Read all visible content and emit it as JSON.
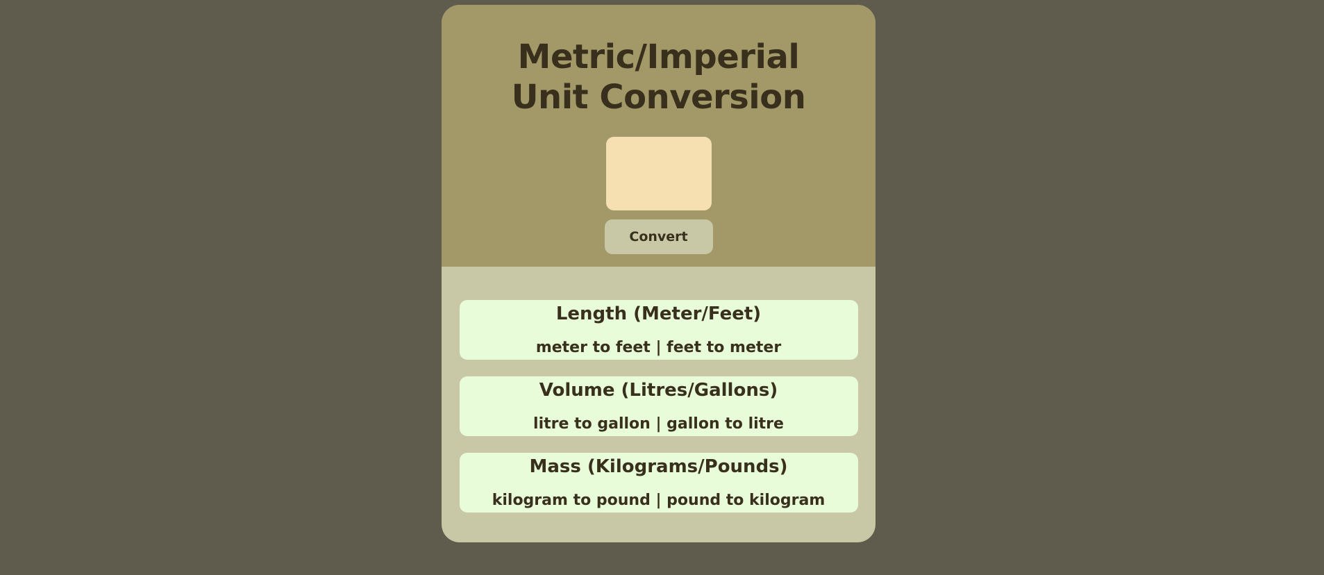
{
  "header": {
    "title": "Metric/Imperial Unit Conversion",
    "input_value": "",
    "convert_label": "Convert"
  },
  "results": [
    {
      "title": "Length (Meter/Feet)",
      "text": "meter to feet | feet to meter"
    },
    {
      "title": "Volume (Litres/Gallons)",
      "text": "litre to gallon | gallon to litre"
    },
    {
      "title": "Mass (Kilograms/Pounds)",
      "text": "kilogram to pound | pound to kilogram"
    }
  ],
  "colors": {
    "page_background": "#5f5b4d",
    "header_background": "#a39867",
    "results_background": "#c8c8a6",
    "input_background": "#f6dfb1",
    "result_card_background": "#e8fcd9",
    "text": "#38301c"
  }
}
